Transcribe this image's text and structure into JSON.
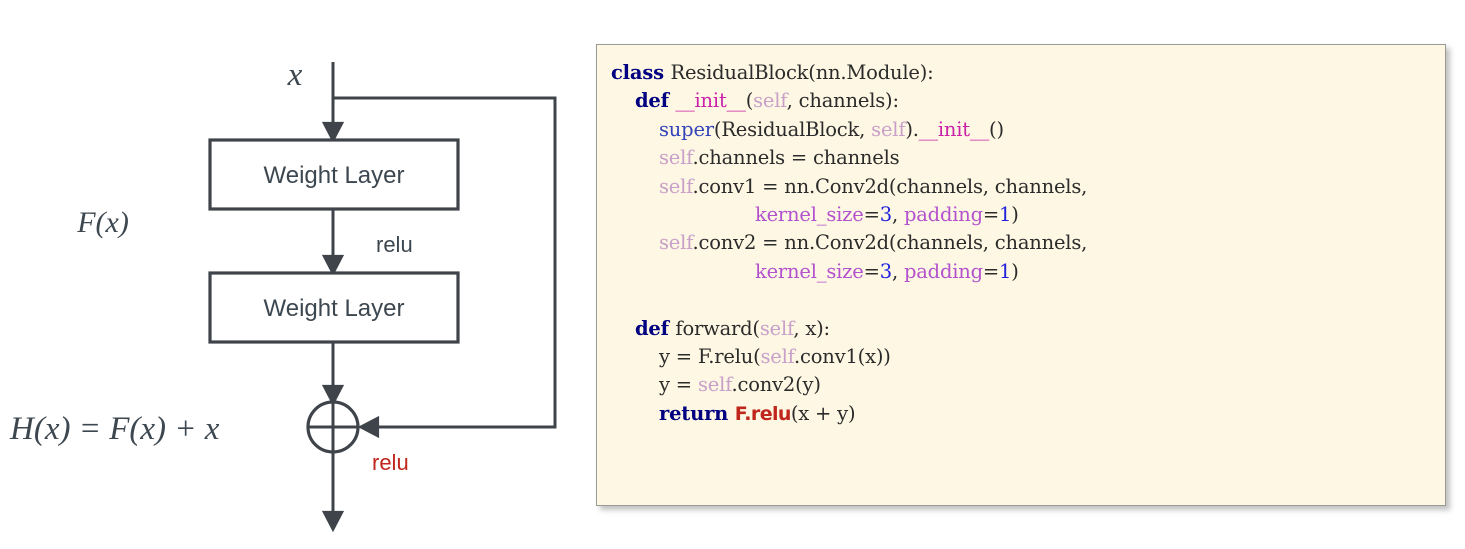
{
  "diagram": {
    "input_label": "x",
    "residual_label": "F(x)",
    "output_label": "H(x) = F(x) + x",
    "box_top_label": "Weight Layer",
    "box_bottom_label": "Weight Layer",
    "relu_mid_label": "relu",
    "relu_out_label": "relu",
    "colors": {
      "stroke": "#3f444a",
      "text": "#3d4750",
      "relu_red": "#c0261c"
    }
  },
  "code": {
    "background": "#fdf7e3",
    "border": "#9a9a94",
    "language": "python",
    "colors": {
      "keyword": "#000080",
      "dunder": "#cc22aa",
      "self": "#c9a0c9",
      "function": "#3344bb",
      "kwarg": "#b452cd",
      "number": "#2222dd",
      "highlight": "#c0261c",
      "plain": "#2b2b2b"
    },
    "lines": [
      [
        {
          "t": "class ",
          "c": "tok-kw"
        },
        {
          "t": "ResidualBlock(nn.Module):",
          "c": "tok-plain"
        }
      ],
      [
        {
          "t": "    ",
          "c": "tok-plain"
        },
        {
          "t": "def ",
          "c": "tok-kw"
        },
        {
          "t": "__init__",
          "c": "tok-dunder"
        },
        {
          "t": "(",
          "c": "tok-plain"
        },
        {
          "t": "self",
          "c": "tok-self"
        },
        {
          "t": ", channels):",
          "c": "tok-plain"
        }
      ],
      [
        {
          "t": "        ",
          "c": "tok-plain"
        },
        {
          "t": "super",
          "c": "tok-func"
        },
        {
          "t": "(ResidualBlock, ",
          "c": "tok-plain"
        },
        {
          "t": "self",
          "c": "tok-self"
        },
        {
          "t": ").",
          "c": "tok-plain"
        },
        {
          "t": "__init__",
          "c": "tok-dunder"
        },
        {
          "t": "()",
          "c": "tok-plain"
        }
      ],
      [
        {
          "t": "        ",
          "c": "tok-plain"
        },
        {
          "t": "self",
          "c": "tok-self"
        },
        {
          "t": ".channels = channels",
          "c": "tok-plain"
        }
      ],
      [
        {
          "t": "        ",
          "c": "tok-plain"
        },
        {
          "t": "self",
          "c": "tok-self"
        },
        {
          "t": ".conv1 = nn.Conv2d(channels, channels,",
          "c": "tok-plain"
        }
      ],
      [
        {
          "t": "                        ",
          "c": "tok-plain"
        },
        {
          "t": "kernel_size",
          "c": "tok-kwarg"
        },
        {
          "t": "=",
          "c": "tok-plain"
        },
        {
          "t": "3",
          "c": "tok-num"
        },
        {
          "t": ", ",
          "c": "tok-plain"
        },
        {
          "t": "padding",
          "c": "tok-kwarg"
        },
        {
          "t": "=",
          "c": "tok-plain"
        },
        {
          "t": "1",
          "c": "tok-num"
        },
        {
          "t": ")",
          "c": "tok-plain"
        }
      ],
      [
        {
          "t": "        ",
          "c": "tok-plain"
        },
        {
          "t": "self",
          "c": "tok-self"
        },
        {
          "t": ".conv2 = nn.Conv2d(channels, channels,",
          "c": "tok-plain"
        }
      ],
      [
        {
          "t": "                        ",
          "c": "tok-plain"
        },
        {
          "t": "kernel_size",
          "c": "tok-kwarg"
        },
        {
          "t": "=",
          "c": "tok-plain"
        },
        {
          "t": "3",
          "c": "tok-num"
        },
        {
          "t": ", ",
          "c": "tok-plain"
        },
        {
          "t": "padding",
          "c": "tok-kwarg"
        },
        {
          "t": "=",
          "c": "tok-plain"
        },
        {
          "t": "1",
          "c": "tok-num"
        },
        {
          "t": ")",
          "c": "tok-plain"
        }
      ],
      [
        {
          "t": " ",
          "c": "tok-plain"
        }
      ],
      [
        {
          "t": "    ",
          "c": "tok-plain"
        },
        {
          "t": "def ",
          "c": "tok-kw"
        },
        {
          "t": "forward(",
          "c": "tok-plain"
        },
        {
          "t": "self",
          "c": "tok-self"
        },
        {
          "t": ", x):",
          "c": "tok-plain"
        }
      ],
      [
        {
          "t": "        y = F.relu(",
          "c": "tok-plain"
        },
        {
          "t": "self",
          "c": "tok-self"
        },
        {
          "t": ".conv1(x))",
          "c": "tok-plain"
        }
      ],
      [
        {
          "t": "        y = ",
          "c": "tok-plain"
        },
        {
          "t": "self",
          "c": "tok-self"
        },
        {
          "t": ".conv2(y)",
          "c": "tok-plain"
        }
      ],
      [
        {
          "t": "        ",
          "c": "tok-plain"
        },
        {
          "t": "return ",
          "c": "tok-kw"
        },
        {
          "t": "F.relu",
          "c": "tok-relu-hl"
        },
        {
          "t": "(x + y)",
          "c": "tok-plain"
        }
      ]
    ]
  }
}
